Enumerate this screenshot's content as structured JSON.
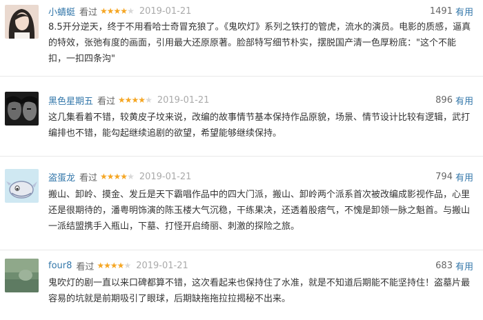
{
  "reviews": [
    {
      "user": "小蜻蜓",
      "status": "看过",
      "rating": 4,
      "date": "2019-01-21",
      "votes": "1491",
      "useful": "有用",
      "content": "8.5开分逆天，终于不用看哈士奇冒充狼了。《鬼吹灯》系列之铁打的管虎，流水的演员。电影的质感，逼真的特效，张弛有度的画面，引用最大还原原著。脸部特写细节朴实，摆脱国产清一色厚粉底：\"这个不能扣，一扣四条沟\""
    },
    {
      "user": "黑色星期五",
      "status": "看过",
      "rating": 4,
      "date": "2019-01-21",
      "votes": "896",
      "useful": "有用",
      "content": "这几集看着不错，较黄皮子坟来说，改编的故事情节基本保持作品原貌，场景、情节设计比较有逻辑，武打编排也不错，能勾起继续追剧的欲望，希望能够继续保持。"
    },
    {
      "user": "盗蛋龙",
      "status": "看过",
      "rating": 4,
      "date": "2019-01-21",
      "votes": "794",
      "useful": "有用",
      "content": "搬山、卸岭、摸金、发丘是天下霸唱作品中的四大门派，搬山、卸岭两个派系首次被改编成影视作品，心里还是很期待的，潘粤明饰演的陈玉楼大气沉稳，干练果决，还透着股痞气，不愧是卸领一脉之魁首。与搬山一派结盟携手入瓶山，下墓、打怪开启绮丽、刺激的探险之旅。"
    },
    {
      "user": "four8",
      "status": "看过",
      "rating": 4,
      "date": "2019-01-21",
      "votes": "683",
      "useful": "有用",
      "content": "鬼吹灯的剧一直以来口碑都算不错，这次看起来也保持住了水准，就是不知道后期能不能坚持住！盗墓片最容易的坑就是前期吸引了眼球，后期缺拖拖拉拉揭秘不出来。"
    }
  ],
  "colors": {
    "link": "#3377aa",
    "star": "#f5a623",
    "meta": "#aaaaaa",
    "text": "#333333"
  }
}
